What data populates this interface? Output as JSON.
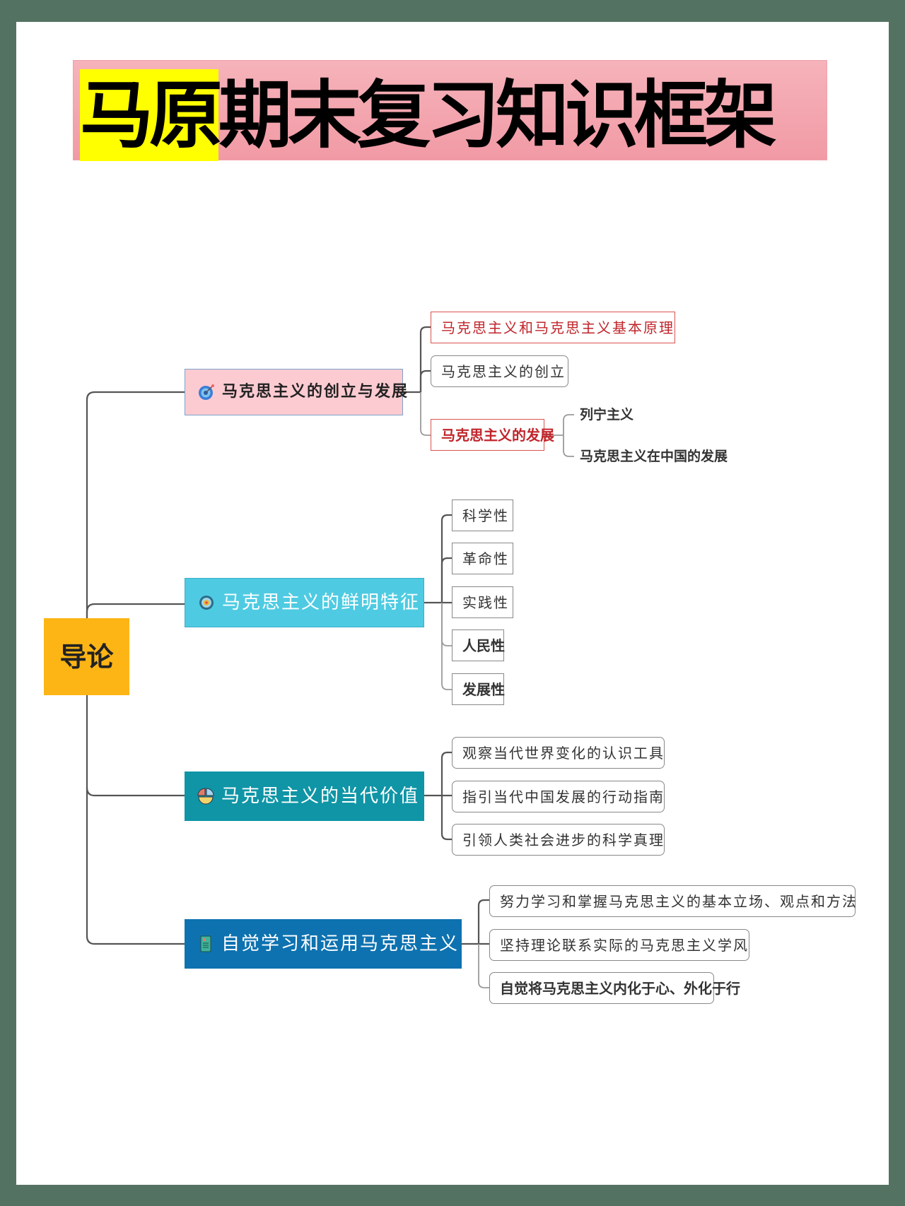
{
  "title": {
    "highlight": "马原",
    "rest": "期末复习知识框架"
  },
  "colors": {
    "background": "#547262",
    "title_bg": "#f4a9b2",
    "title_highlight": "#ffff00",
    "root": "#fdb515",
    "branch_pink": "#fccbd2",
    "branch_cyan": "#4ecbe2",
    "branch_teal": "#0f95a6",
    "branch_blue": "#0e72b0",
    "accent_red": "#c0252b"
  },
  "mindmap": {
    "root": "导论",
    "branches": [
      {
        "label": "马克思主义的创立与发展",
        "icon": "target-icon",
        "children": [
          {
            "label": "马克思主义和马克思主义基本原理",
            "style": "red"
          },
          {
            "label": "马克思主义的创立",
            "style": "rounded"
          },
          {
            "label": "马克思主义的发展",
            "style": "red-bold",
            "children": [
              {
                "label": "列宁主义"
              },
              {
                "label": "马克思主义在中国的发展"
              }
            ]
          }
        ]
      },
      {
        "label": "马克思主义的鲜明特征",
        "icon": "compass-icon",
        "children": [
          {
            "label": "科学性"
          },
          {
            "label": "革命性"
          },
          {
            "label": "实践性"
          },
          {
            "label": "人民性"
          },
          {
            "label": "发展性"
          }
        ]
      },
      {
        "label": "马克思主义的当代价值",
        "icon": "pie-chart-icon",
        "children": [
          {
            "label": "观察当代世界变化的认识工具"
          },
          {
            "label": "指引当代中国发展的行动指南"
          },
          {
            "label": "引领人类社会进步的科学真理"
          }
        ]
      },
      {
        "label": "自觉学习和运用马克思主义",
        "icon": "book-icon",
        "children": [
          {
            "label": "努力学习和掌握马克思主义的基本立场、观点和方法"
          },
          {
            "label": "坚持理论联系实际的马克思主义学风"
          },
          {
            "label": "自觉将马克思主义内化于心、外化于行"
          }
        ]
      }
    ]
  }
}
